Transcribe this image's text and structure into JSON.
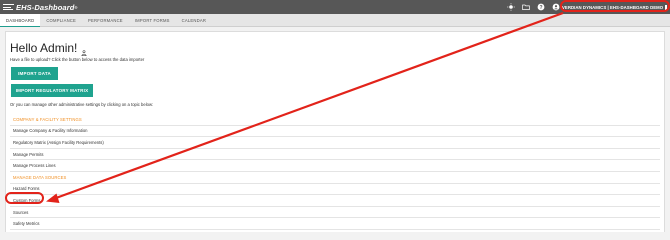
{
  "app": {
    "name": "EHS-Dashboard",
    "trademark": "®"
  },
  "header": {
    "org_label": "VERDIAN DYNAMICS | EHS-DASHBOARD DEMO",
    "icons": [
      "sun-icon",
      "folder-icon",
      "help-icon",
      "user-icon"
    ]
  },
  "nav": {
    "tabs": [
      "DASHBOARD",
      "COMPLIANCE",
      "PERFORMANCE",
      "IMPORT FORMS",
      "CALENDAR"
    ],
    "active_tab": "DASHBOARD"
  },
  "main": {
    "greeting": "Hello Admin!",
    "upload_prompt": "Have a file to upload? Click the button below to access the data importer",
    "import_data_label": "IMPORT DATA",
    "import_matrix_label": "IMPORT REGULATORY MATRIX",
    "manage_prompt": "Or you can manage other administrative settings by clicking on a topic below:",
    "sections": [
      {
        "title": "COMPANY & FACILITY SETTINGS",
        "items": [
          "Manage Company & Facility Information",
          "Regulatory Matrix (Assign Facility Requirements)",
          "Manage Permits",
          "Manage Process Lines"
        ]
      },
      {
        "title": "MANAGE DATA SOURCES",
        "items": [
          "Hazard Forms",
          "Custom Forms",
          "Sources",
          "Safety Metrics"
        ]
      }
    ]
  },
  "annotation": {
    "color": "#e2231a"
  }
}
